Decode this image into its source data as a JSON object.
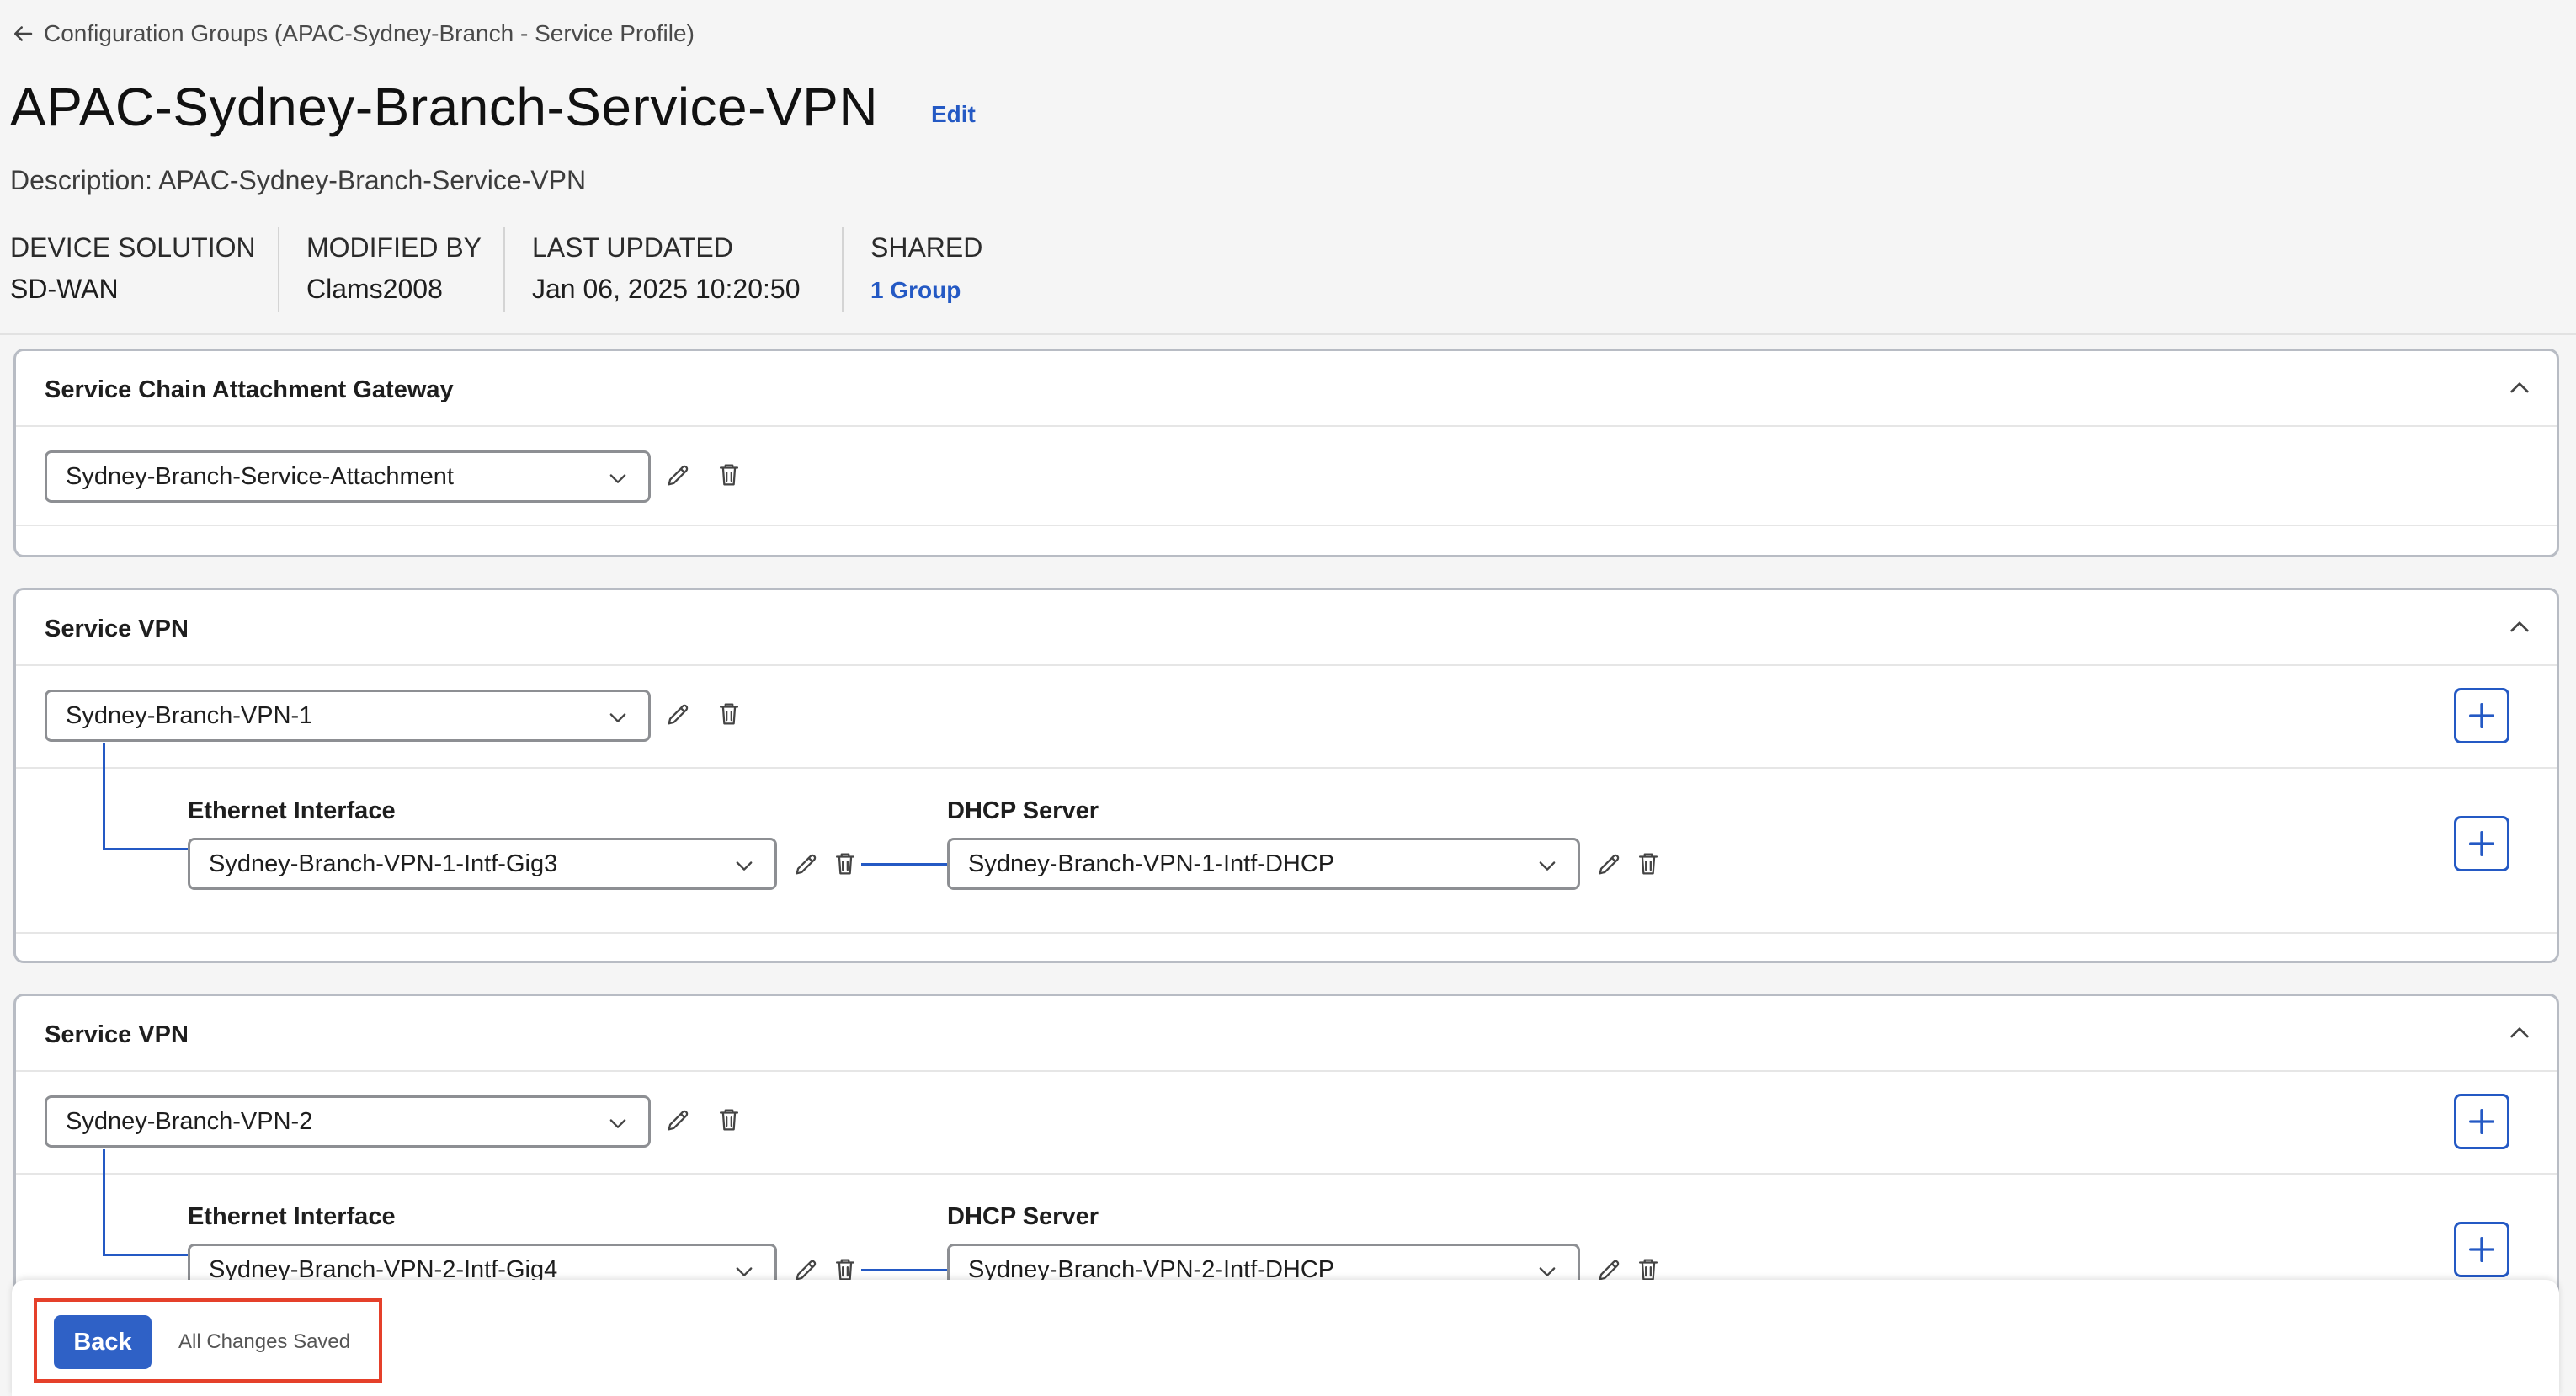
{
  "breadcrumb": {
    "text": "Configuration Groups (APAC-Sydney-Branch - Service Profile)"
  },
  "page": {
    "title": "APAC-Sydney-Branch-Service-VPN",
    "edit_label": "Edit",
    "description": "Description: APAC-Sydney-Branch-Service-VPN"
  },
  "meta": {
    "device_solution_label": "DEVICE SOLUTION",
    "device_solution_value": "SD-WAN",
    "modified_by_label": "MODIFIED BY",
    "modified_by_value": "Clams2008",
    "last_updated_label": "LAST UPDATED",
    "last_updated_value": "Jan 06, 2025 10:20:50",
    "shared_label": "SHARED",
    "shared_value": "1 Group"
  },
  "sections": [
    {
      "title": "Service Chain Attachment Gateway",
      "select_value": "Sydney-Branch-Service-Attachment"
    },
    {
      "title": "Service VPN",
      "select_value": "Sydney-Branch-VPN-1",
      "ethernet_label": "Ethernet Interface",
      "ethernet_value": "Sydney-Branch-VPN-1-Intf-Gig3",
      "dhcp_label": "DHCP Server",
      "dhcp_value": "Sydney-Branch-VPN-1-Intf-DHCP"
    },
    {
      "title": "Service VPN",
      "select_value": "Sydney-Branch-VPN-2",
      "ethernet_label": "Ethernet Interface",
      "ethernet_value": "Sydney-Branch-VPN-2-Intf-Gig4",
      "dhcp_label": "DHCP Server",
      "dhcp_value": "Sydney-Branch-VPN-2-Intf-DHCP"
    }
  ],
  "footer": {
    "back_label": "Back",
    "status": "All Changes Saved"
  },
  "colors": {
    "accent": "#2459c4",
    "button": "#2f61c6",
    "highlight": "#e5402a"
  }
}
